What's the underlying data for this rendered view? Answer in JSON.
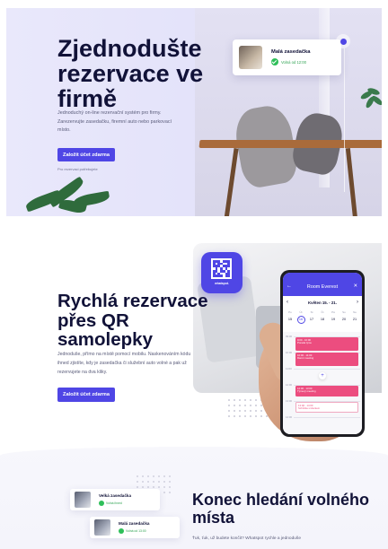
{
  "hero": {
    "title": "Zjednodušte rezervace ve firmě",
    "description": "Jednoduchý on-line rezervační systém pro firmy. Zarezervujte zasedačku, firemní auto nebo parkovací místo.",
    "cta_label": "Založit účet zdarma",
    "note": "Pro rezervaci potřebujete",
    "room_card": {
      "name": "Malá zasedačka",
      "status": "Volná od 12:00"
    }
  },
  "qr": {
    "title": "Rychlá rezervace přes QR samolepky",
    "description": "Jednoduše, přímo na místě pomocí mobilu. Naskenováním kódu ihned zjistíte, kdy je zasedačka či služební auto volné a pak už rezervujete na dva kliky.",
    "cta_label": "Založit účet zdarma",
    "sticker_label": "whatspot."
  },
  "phone_app": {
    "title": "Room Everest",
    "week": "Květen 15. - 21.",
    "days": [
      {
        "name": "Po",
        "num": "15"
      },
      {
        "name": "Út",
        "num": "16"
      },
      {
        "name": "St",
        "num": "17"
      },
      {
        "name": "Čt",
        "num": "18"
      },
      {
        "name": "Pá",
        "num": "19"
      },
      {
        "name": "So",
        "num": "20"
      },
      {
        "name": "Ne",
        "num": "21"
      }
    ],
    "hours": [
      "09:00",
      "10:00",
      "11:00",
      "12:00",
      "13:00",
      "14:00"
    ],
    "events": [
      {
        "time": "9:00 - 10:00",
        "title": "Porada týmu"
      },
      {
        "time": "10:00 - 11:00",
        "title": "Ranní meeting"
      },
      {
        "time": "12:00 - 13:00",
        "title": "Týmový meeting"
      },
      {
        "time": "13:00 - 14:00",
        "title": "Schůzka s klientem"
      }
    ]
  },
  "section3": {
    "title": "Konec hledání volného místa",
    "description": "Ťuk, ťuk, už budete končit? Whatspot rychle a jednoduše",
    "cards": [
      {
        "name": "Velká zasedačka",
        "status": "Volná ihned"
      },
      {
        "name": "Malá zasedačka",
        "status": "Volná od 13:00"
      }
    ]
  },
  "colors": {
    "accent": "#4f46e5",
    "success": "#2fbf5a",
    "event": "#ec4d7f",
    "heading": "#111238"
  }
}
